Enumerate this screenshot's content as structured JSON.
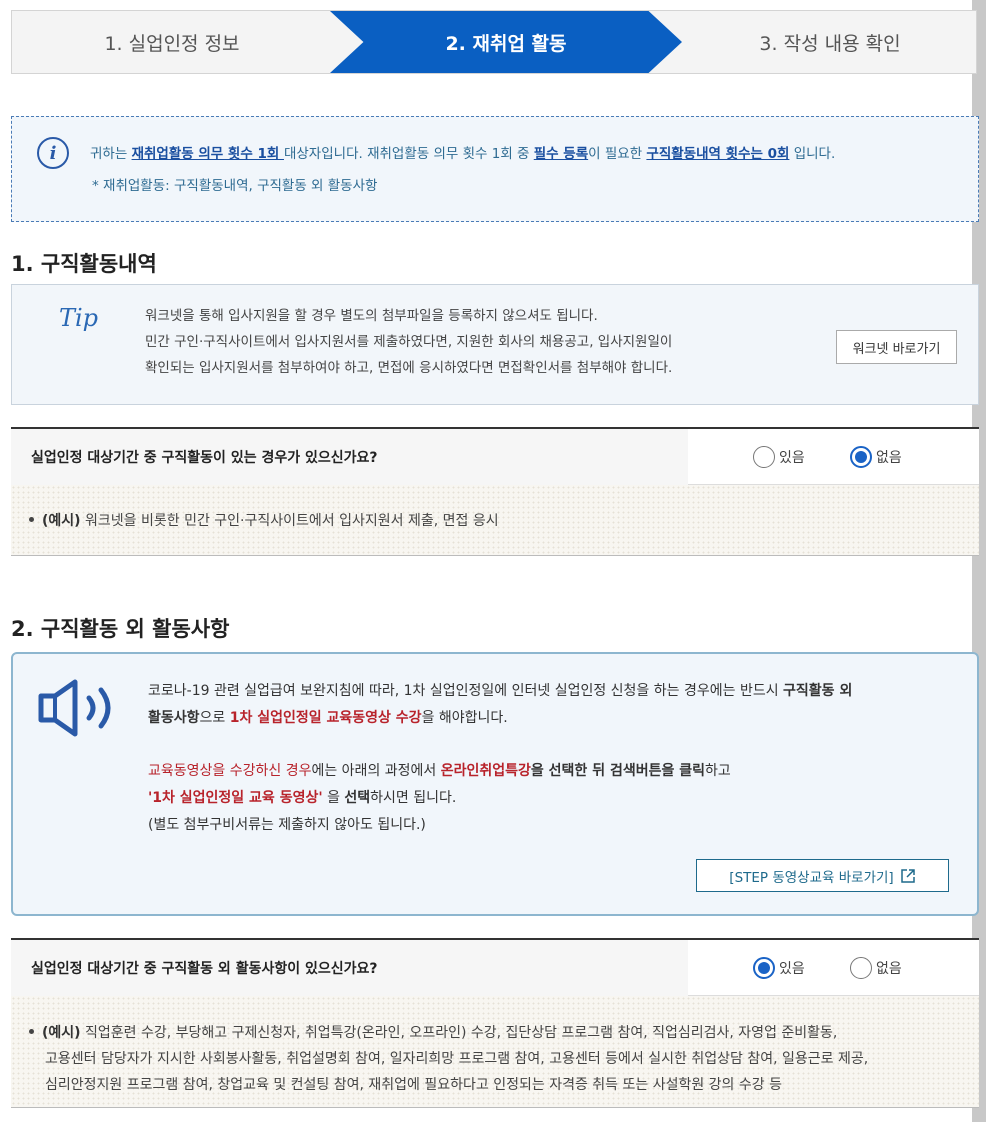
{
  "steps": [
    {
      "label": "1. 실업인정 정보"
    },
    {
      "label": "2. 재취업 활동"
    },
    {
      "label": "3. 작성 내용 확인"
    }
  ],
  "notice": {
    "p1": "귀하는 ",
    "hl1": "재취업활동 의무 횟수 1회 ",
    "p2": "대상자입니다. 재취업활동 의무 횟수 1회 중 ",
    "hl2": "필수 등록",
    "p3": "이 필요한 ",
    "hl3": "구직활동내역 횟수는 0회",
    "p4": " 입니다.",
    "line2": "* 재취업활동: 구직활동내역, 구직활동 외 활동사항"
  },
  "section1": {
    "title": "1. 구직활동내역",
    "tip_mark": "Tip",
    "tip_lines": [
      "워크넷을 통해 입사지원을 할 경우 별도의 첨부파일을 등록하지 않으셔도 됩니다.",
      "민간 구인·구직사이트에서 입사지원서를 제출하였다면, 지원한 회사의 채용공고, 입사지원일이",
      "확인되는 입사지원서를 첨부하여야 하고, 면접에 응시하였다면 면접확인서를 첨부해야 합니다."
    ],
    "worknet_button": "워크넷 바로가기",
    "question": "실업인정 대상기간 중 구직활동이 있는 경우가 있으신가요?",
    "options": [
      "있음",
      "없음"
    ],
    "selected": "없음",
    "example_prefix": "(예시)",
    "example_text": " 워크넷을 비롯한 민간 구인·구직사이트에서 입사지원서 제출, 면접 응시"
  },
  "section2": {
    "title": "2. 구직활동 외 활동사항",
    "c1": "코로나-19 관련 실업급여 보완지침에 따라, 1차 실업인정일에 인터넷 실업인정 신청을 하는 경우에는 반드시 ",
    "c1b": "구직활동 외",
    "c2b": "활동사항",
    "c2": "으로 ",
    "c2r": "1차 실업인정일 교육동영상 수강",
    "c2e": "을 해야합니다.",
    "c3r": "교육동영상을 수강하신 경우",
    "c3": "에는 아래의 과정에서 ",
    "c3rb": "온라인취업특강",
    "c3b": "을 선택한 뒤 검색버튼을 클릭",
    "c3e": "하고",
    "c4r": "'1차 실업인정일 교육 동영상'",
    "c4": " 을 ",
    "c4b": "선택",
    "c4e": "하시면 됩니다.",
    "c5": "(별도 첨부구비서류는 제출하지 않아도 됩니다.)",
    "step_button": "[STEP 동영상교육 바로가기]",
    "question": "실업인정 대상기간 중 구직활동 외 활동사항이 있으신가요?",
    "options": [
      "있음",
      "없음"
    ],
    "selected": "있음",
    "example_prefix": "(예시)",
    "example_line1": " 직업훈련 수강, 부당해고 구제신청자, 취업특강(온라인, 오프라인) 수강, 집단상담 프로그램 참여, 직업심리검사, 자영업 준비활동,",
    "example_line2": "고용센터 담당자가 지시한 사회봉사활동, 취업설명회 참여, 일자리희망 프로그램 참여, 고용센터 등에서 실시한 취업상담 참여, 일용근로 제공,",
    "example_line3": "심리안정지원 프로그램 참여, 창업교육 및 컨설팅 참여, 재취업에 필요하다고 인정되는 자격증 취득 또는 사설학원 강의 수강 등"
  },
  "colors": {
    "primary": "#0a5fc2",
    "accent_red": "#b8232b",
    "link": "#1a4fa0"
  }
}
